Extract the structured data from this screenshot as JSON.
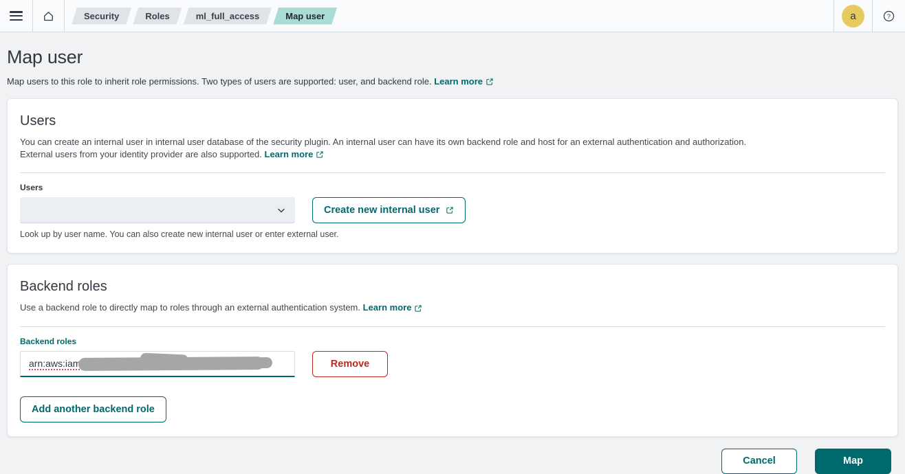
{
  "header": {
    "breadcrumbs": [
      {
        "label": "Security"
      },
      {
        "label": "Roles"
      },
      {
        "label": "ml_full_access"
      },
      {
        "label": "Map user"
      }
    ],
    "avatar_initial": "a",
    "icons": {
      "menu": "hamburger-menu",
      "home": "home-outline",
      "help": "question-mark-circle"
    }
  },
  "page": {
    "title": "Map user",
    "description": "Map users to this role to inherit role permissions. Two types of users are supported: user, and backend role.",
    "learn_more_label": "Learn more"
  },
  "users_panel": {
    "title": "Users",
    "description_line1": "You can create an internal user in internal user database of the security plugin. An internal user can have its own backend role and host for an external authentication and authorization.",
    "description_line2": "External users from your identity provider are also supported.",
    "learn_more_label": "Learn more",
    "field_label": "Users",
    "combobox_value": "",
    "create_button_label": "Create new internal user",
    "help_text": "Look up by user name. You can also create new internal user or enter external user."
  },
  "backend_panel": {
    "title": "Backend roles",
    "description": "Use a backend role to directly map to roles through an external authentication system.",
    "learn_more_label": "Learn more",
    "field_label": "Backend roles",
    "input_value": "arn:aws:iam",
    "input_value_redacted": true,
    "remove_button_label": "Remove",
    "add_button_label": "Add another backend role"
  },
  "actions": {
    "cancel_label": "Cancel",
    "map_label": "Map"
  },
  "colors": {
    "primary_teal": "#00696e",
    "danger_red": "#bd271e",
    "breadcrumb_active_bg": "#abdcd4",
    "avatar_yellow": "#e7ca5f",
    "redaction_gray": "#a6a6a9"
  }
}
